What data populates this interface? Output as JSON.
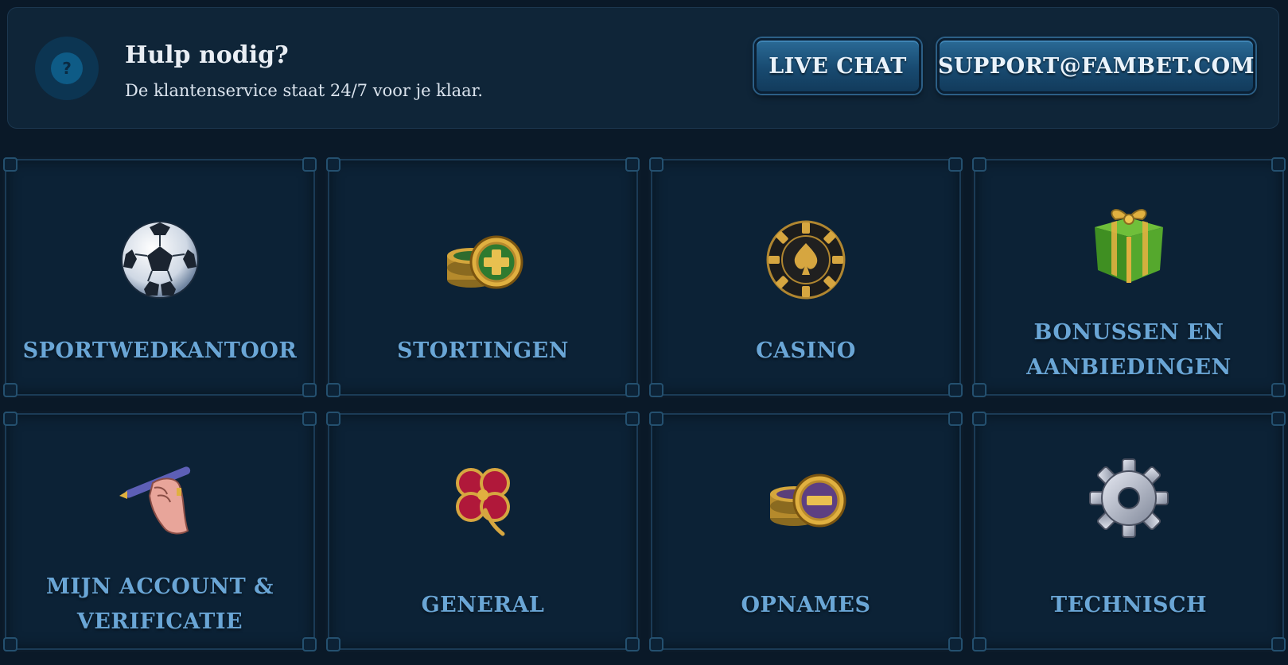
{
  "help": {
    "title": "Hulp nodig?",
    "subtitle": "De klantenservice staat 24/7 voor je klaar.",
    "icon": "question-icon",
    "icon_glyph": "?",
    "live_chat_label": "LIVE CHAT",
    "email_label": "SUPPORT@FAMBET.COM"
  },
  "categories": [
    {
      "label": "SPORTWEDKANTOOR",
      "icon": "soccer-ball-icon"
    },
    {
      "label": "STORTINGEN",
      "icon": "coin-plus-icon"
    },
    {
      "label": "CASINO",
      "icon": "casino-chip-icon"
    },
    {
      "label_line1": "BONUSSEN EN",
      "label_line2": "AANBIEDINGEN",
      "icon": "gift-icon"
    },
    {
      "label_line1": "MIJN ACCOUNT &",
      "label_line2": "VERIFICATIE",
      "icon": "hand-pen-icon"
    },
    {
      "label": "GENERAL",
      "icon": "clover-icon"
    },
    {
      "label": "OPNAMES",
      "icon": "coin-minus-icon"
    },
    {
      "label": "TECHNISCH",
      "icon": "gear-icon"
    }
  ],
  "colors": {
    "background": "#0a1928",
    "card": "#0c2236",
    "label": "#6aa6d6",
    "button": "#1e5a85"
  }
}
